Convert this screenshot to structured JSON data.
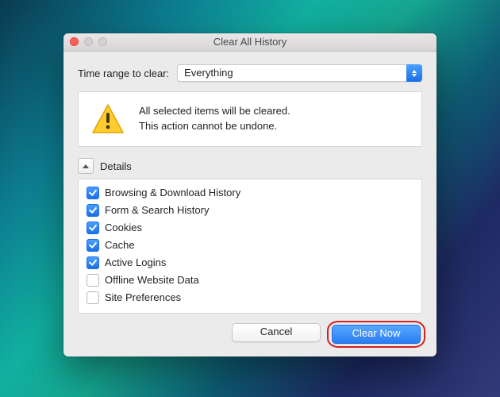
{
  "window": {
    "title": "Clear All History"
  },
  "range": {
    "label": "Time range to clear:",
    "value": "Everything"
  },
  "warning": {
    "line1": "All selected items will be cleared.",
    "line2": "This action cannot be undone."
  },
  "details": {
    "label": "Details",
    "items": [
      {
        "label": "Browsing & Download History",
        "checked": true
      },
      {
        "label": "Form & Search History",
        "checked": true
      },
      {
        "label": "Cookies",
        "checked": true
      },
      {
        "label": "Cache",
        "checked": true
      },
      {
        "label": "Active Logins",
        "checked": true
      },
      {
        "label": "Offline Website Data",
        "checked": false
      },
      {
        "label": "Site Preferences",
        "checked": false
      }
    ]
  },
  "buttons": {
    "cancel": "Cancel",
    "clear": "Clear Now"
  }
}
